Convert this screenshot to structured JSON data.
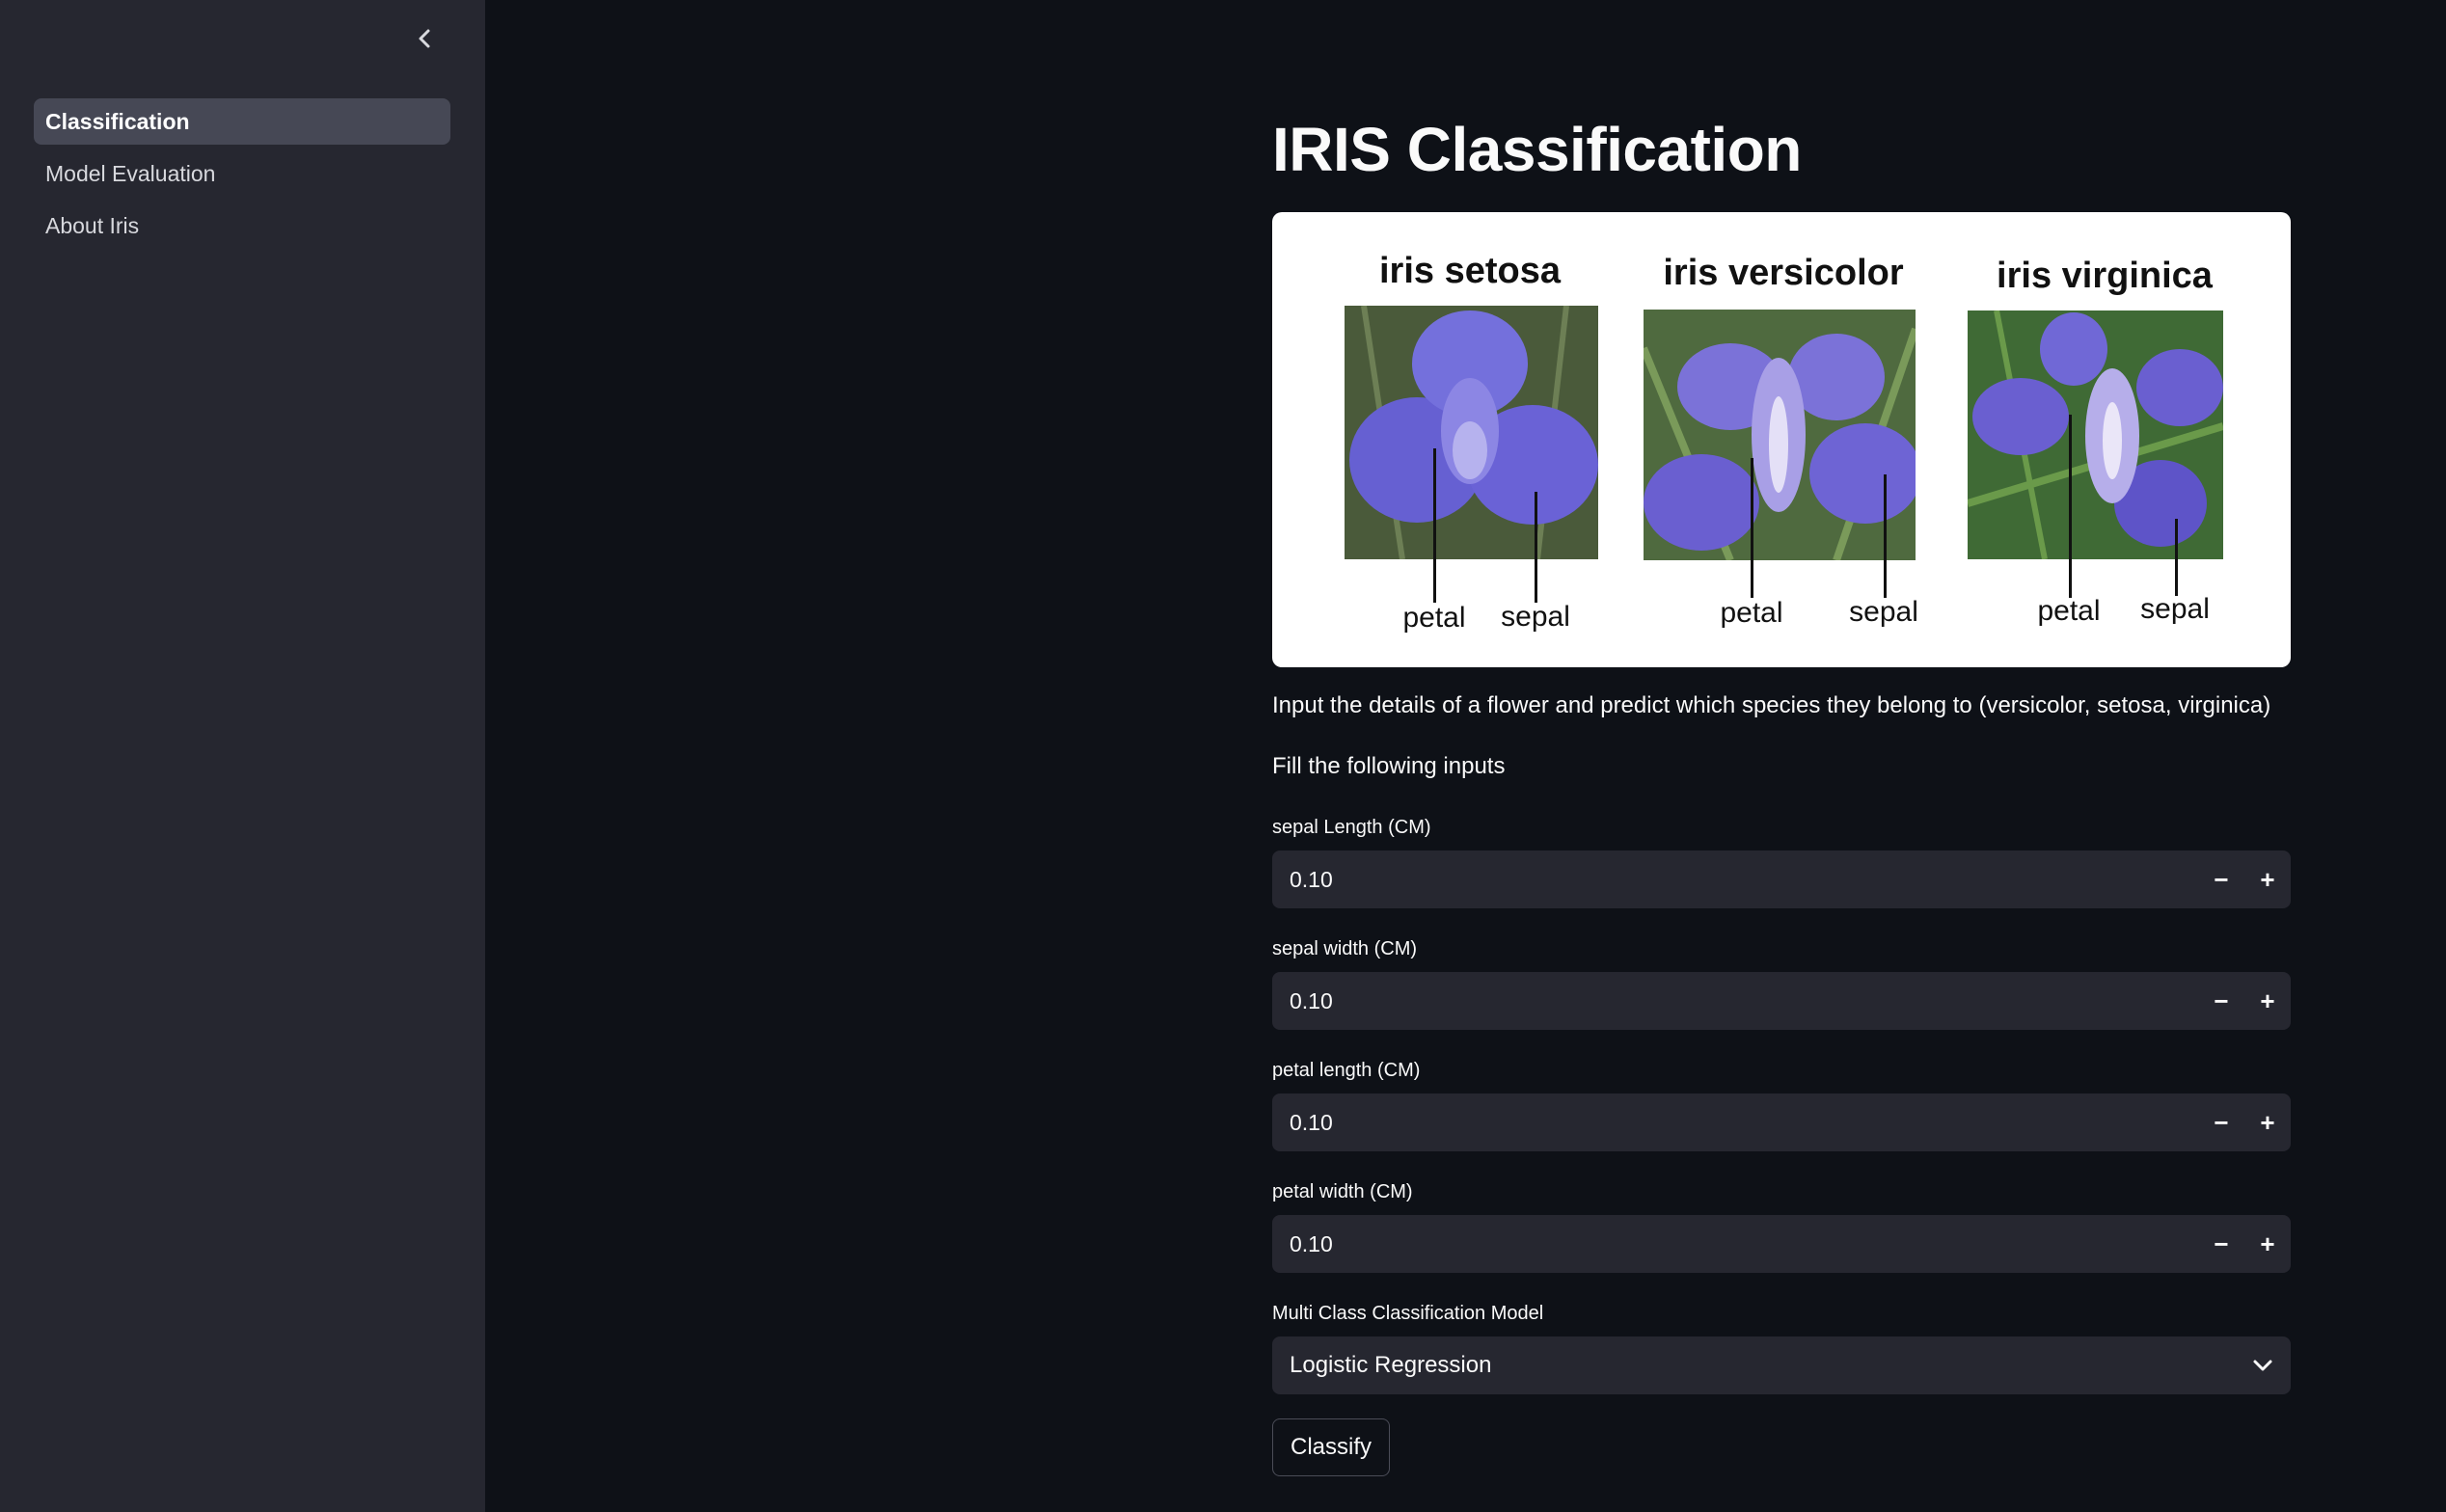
{
  "sidebar": {
    "items": [
      {
        "label": "Classification",
        "active": true
      },
      {
        "label": "Model Evaluation",
        "active": false
      },
      {
        "label": "About Iris",
        "active": false
      }
    ]
  },
  "main": {
    "title": "IRIS Classification",
    "image": {
      "species": [
        {
          "name": "iris setosa",
          "petal_label": "petal",
          "sepal_label": "sepal"
        },
        {
          "name": "iris versicolor",
          "petal_label": "petal",
          "sepal_label": "sepal"
        },
        {
          "name": "iris virginica",
          "petal_label": "petal",
          "sepal_label": "sepal"
        }
      ]
    },
    "description": "Input the details of a flower and predict which species they belong to (versicolor, setosa, virginica)",
    "fill_prompt": "Fill the following inputs",
    "inputs": [
      {
        "label": "sepal Length (CM)",
        "value": "0.10"
      },
      {
        "label": "sepal width (CM)",
        "value": "0.10"
      },
      {
        "label": "petal length (CM)",
        "value": "0.10"
      },
      {
        "label": "petal width (CM)",
        "value": "0.10"
      }
    ],
    "stepper": {
      "minus": "−",
      "plus": "+"
    },
    "model_select": {
      "label": "Multi Class Classification Model",
      "value": "Logistic Regression"
    },
    "classify_label": "Classify"
  },
  "colors": {
    "background": "#0e1117",
    "sidebar": "#262730",
    "input_bg": "#262730",
    "flower_purple": "#6a5fd0"
  }
}
